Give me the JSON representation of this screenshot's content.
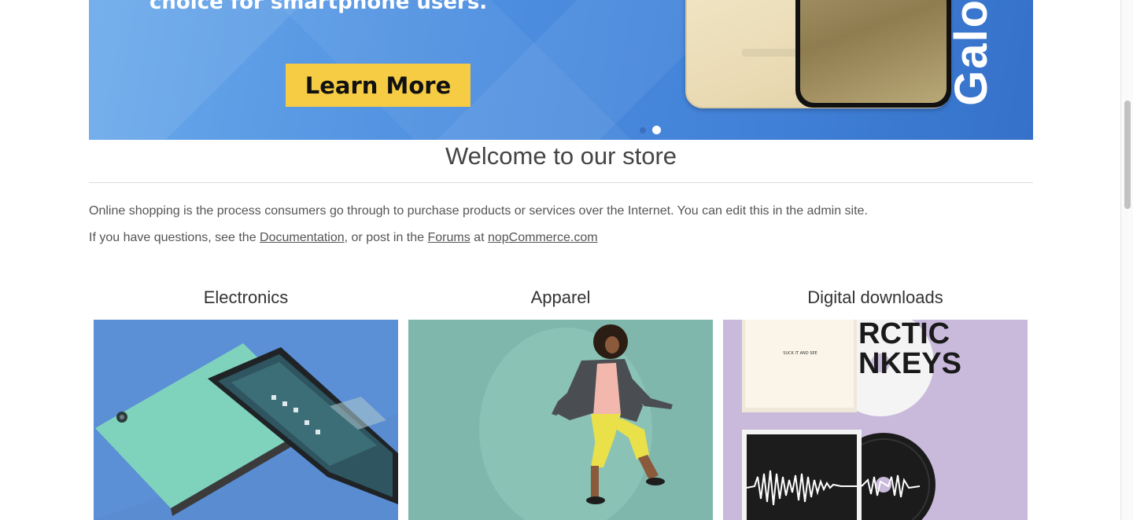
{
  "banner": {
    "headline": "choice for smartphone users.",
    "cta_label": "Learn More",
    "phone_brand_text": "Galo",
    "slides": 2,
    "active_slide": 2,
    "colors": {
      "background": "#4e8fe0",
      "cta": "#f5cc43"
    }
  },
  "welcome": {
    "title": "Welcome to our store",
    "paragraph1": "Online shopping is the process consumers go through to purchase products or services over the Internet. You can edit this in the admin site.",
    "p2_prefix": "If you have questions, see the ",
    "documentation_link": "Documentation",
    "p2_mid": ", or post in the ",
    "forums_link": "Forums",
    "p2_at": " at ",
    "site_link": "nopCommerce.com"
  },
  "categories": [
    {
      "name": "Electronics",
      "image_background": "#5b8fd6"
    },
    {
      "name": "Apparel",
      "image_background": "#7fb7ac"
    },
    {
      "name": "Digital downloads",
      "image_background": "#c9badb"
    }
  ],
  "album_art": {
    "cover1_text": "SUCK IT AND SEE",
    "cover2_text": "RCTIC NKEYS"
  }
}
